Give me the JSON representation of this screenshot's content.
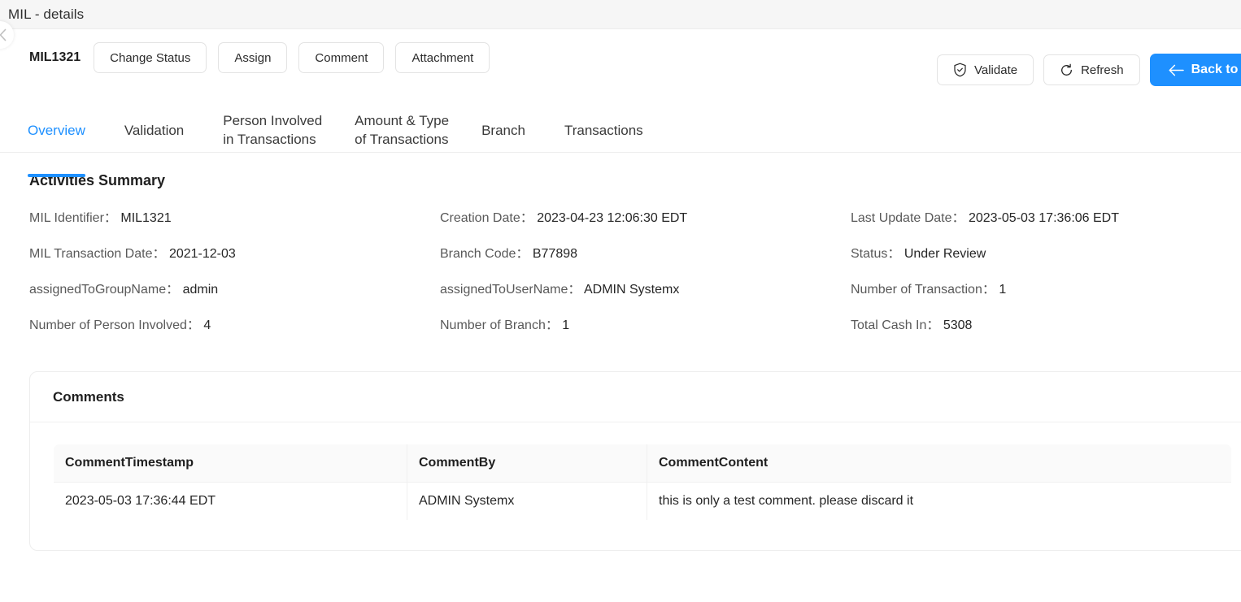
{
  "window": {
    "title": "MIL - details",
    "collapse_icon": "chevron-left-icon"
  },
  "actionbar": {
    "record_id": "MIL1321",
    "left_buttons": [
      {
        "label": "Change Status",
        "name": "change-status-button"
      },
      {
        "label": "Assign",
        "name": "assign-button"
      },
      {
        "label": "Comment",
        "name": "comment-button"
      },
      {
        "label": "Attachment",
        "name": "attachment-button"
      }
    ],
    "right_buttons": [
      {
        "label": "Validate",
        "icon": "shield-check-icon",
        "name": "validate-button"
      },
      {
        "label": "Refresh",
        "icon": "refresh-icon",
        "name": "refresh-button"
      },
      {
        "label": "Back to MIL List",
        "icon": "arrow-left-icon",
        "name": "back-to-mil-list-button"
      }
    ]
  },
  "tabs": {
    "active": "Overview",
    "items": [
      {
        "label": "Overview",
        "name": "tab-overview"
      },
      {
        "label": "Validation",
        "name": "tab-validation"
      },
      {
        "label": "Person Involved\nin Transactions",
        "name": "tab-person-involved-in-transactions"
      },
      {
        "label": "Amount & Type\nof Transactions",
        "name": "tab-amount-type-of-transactions"
      },
      {
        "label": "Branch",
        "name": "tab-branch"
      },
      {
        "label": "Transactions",
        "name": "tab-transactions"
      }
    ]
  },
  "summary": {
    "title": "Activities Summary",
    "fields": [
      {
        "label": "MIL Identifier：",
        "value": "MIL1321",
        "name": "field-mil-identifier"
      },
      {
        "label": "Creation Date：",
        "value": "2023-04-23 12:06:30 EDT",
        "name": "field-creation-date"
      },
      {
        "label": "Last Update Date：",
        "value": "2023-05-03 17:36:06 EDT",
        "name": "field-last-update-date"
      },
      {
        "label": "MIL Transaction Date：",
        "value": "2021-12-03",
        "name": "field-mil-transaction-date"
      },
      {
        "label": "Branch Code：",
        "value": "B77898",
        "name": "field-branch-code"
      },
      {
        "label": "Status：",
        "value": "Under Review",
        "name": "field-status"
      },
      {
        "label": "assignedToGroupName：",
        "value": "admin",
        "name": "field-assigned-to-group-name"
      },
      {
        "label": "assignedToUserName：",
        "value": "ADMIN Systemx",
        "name": "field-assigned-to-user-name"
      },
      {
        "label": "Number of Transaction：",
        "value": "1",
        "name": "field-number-of-transaction"
      },
      {
        "label": "Number of Person Involved：",
        "value": "4",
        "name": "field-number-of-person-involved"
      },
      {
        "label": "Number of Branch：",
        "value": "1",
        "name": "field-number-of-branch"
      },
      {
        "label": "Total Cash In：",
        "value": "5308",
        "name": "field-total-cash-in"
      }
    ]
  },
  "comments": {
    "title": "Comments",
    "columns": [
      "CommentTimestamp",
      "CommentBy",
      "CommentContent"
    ],
    "rows": [
      {
        "timestamp": "2023-05-03 17:36:44 EDT",
        "by": "ADMIN Systemx",
        "content": "this is only a test comment. please discard it"
      }
    ]
  },
  "colors": {
    "accent": "#1e90ff",
    "titlebar_bg": "#f6f6f6",
    "table_header_bg": "#fafafa",
    "border": "#ededed"
  }
}
